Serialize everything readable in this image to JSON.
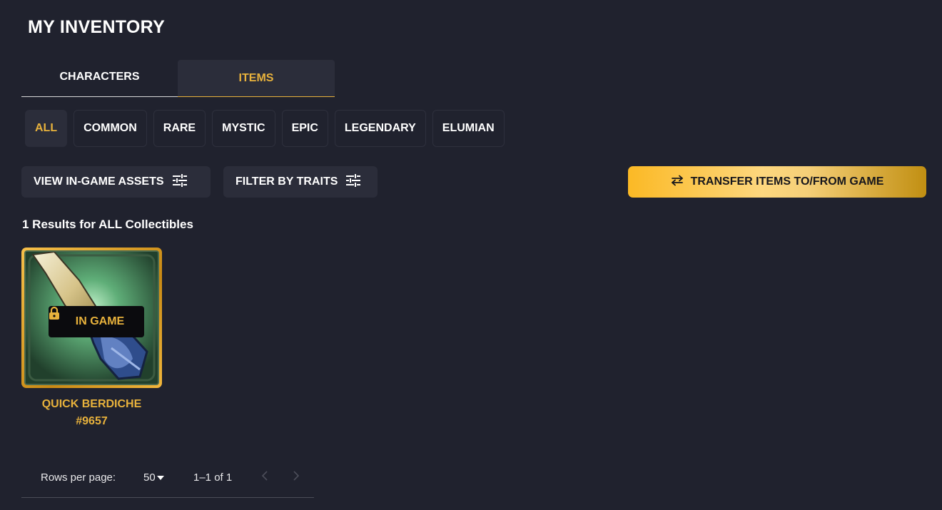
{
  "page": {
    "title": "MY INVENTORY"
  },
  "tabs": [
    {
      "label": "CHARACTERS",
      "active": false
    },
    {
      "label": "ITEMS",
      "active": true
    }
  ],
  "rarity_filters": [
    {
      "label": "ALL",
      "active": true
    },
    {
      "label": "COMMON",
      "active": false
    },
    {
      "label": "RARE",
      "active": false
    },
    {
      "label": "MYSTIC",
      "active": false
    },
    {
      "label": "EPIC",
      "active": false
    },
    {
      "label": "LEGENDARY",
      "active": false
    },
    {
      "label": "ELUMIAN",
      "active": false
    }
  ],
  "actions": {
    "view_in_game_assets": {
      "label": "VIEW IN-GAME ASSETS",
      "icon": "sliders-icon"
    },
    "filter_by_traits": {
      "label": "FILTER BY TRAITS",
      "icon": "sliders-icon"
    },
    "transfer": {
      "label": "TRANSFER ITEMS TO/FROM GAME",
      "icon": "swap-arrows-icon"
    }
  },
  "results_text": "1 Results for ALL Collectibles",
  "items": [
    {
      "name": "QUICK BERDICHE",
      "id": "#9657",
      "badge": "IN GAME",
      "badge_icon": "lock-icon"
    }
  ],
  "pagination": {
    "rows_label": "Rows per page:",
    "rows_value": "50",
    "range": "1–1 of 1"
  },
  "colors": {
    "background": "#20222e",
    "accent_gold": "#e8b23c",
    "surface": "#2b2d3a"
  }
}
